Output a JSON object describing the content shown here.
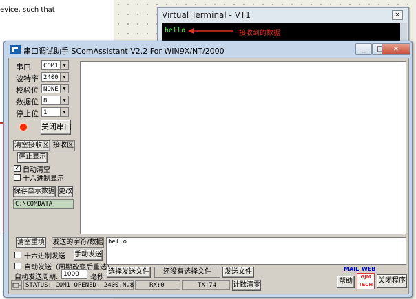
{
  "background": {
    "snippet": "evice, such that"
  },
  "virtual_terminal": {
    "title": "Virtual Terminal - VT1",
    "close": "×",
    "screen_text": "hello",
    "annotation": "接收到的数据"
  },
  "window": {
    "title": "串口调试助手 SComAssistant V2.2 For WIN9X/NT/2000",
    "minimize": "_",
    "maximize": "□",
    "close": "×"
  },
  "settings": {
    "port_label": "串口",
    "port_value": "COM1",
    "baud_label": "波特率",
    "baud_value": "2400",
    "parity_label": "校验位",
    "parity_value": "NONE",
    "databits_label": "数据位",
    "databits_value": "8",
    "stopbits_label": "停止位",
    "stopbits_value": "1"
  },
  "receive": {
    "close_port_button": "关闭串口",
    "clear_receive_button": "清空接收区",
    "receive_area_label": "接收区",
    "stop_display_button": "停止显示",
    "auto_clear_label": "自动清空",
    "auto_clear_checked": true,
    "hex_display_label": "十六进制显示",
    "hex_display_checked": false,
    "save_data_button": "保存显示数据",
    "change_button": "更改",
    "path": "C:\\COMDATA"
  },
  "send": {
    "clear_resend_button": "清空重填",
    "send_area_label": "发送的字符/数据",
    "send_text": "hello",
    "hex_send_label": "十六进制发送",
    "manual_send_button": "手动发送",
    "auto_send_label": "自动发送（周期改变后重选）",
    "period_label": "自动发送周期:",
    "period_value": "1000",
    "period_unit": "毫秒",
    "select_file_button": "选择发送文件",
    "no_file_label": "还没有选择文件",
    "send_file_button": "发送文件",
    "mail_link": "MAIL",
    "web_link": "WEB",
    "help_button": "帮助",
    "logo_text": "GJM TECH",
    "close_program_button": "关闭程序"
  },
  "statusbar": {
    "status": "STATUS: COM1 OPENED, 2400,N,8,1",
    "rx": "RX:0",
    "tx": "TX:74",
    "reset_count_button": "计数清零"
  },
  "colors": {
    "indicator_off": "#ff2a00",
    "terminal_text": "#3cff3c"
  }
}
